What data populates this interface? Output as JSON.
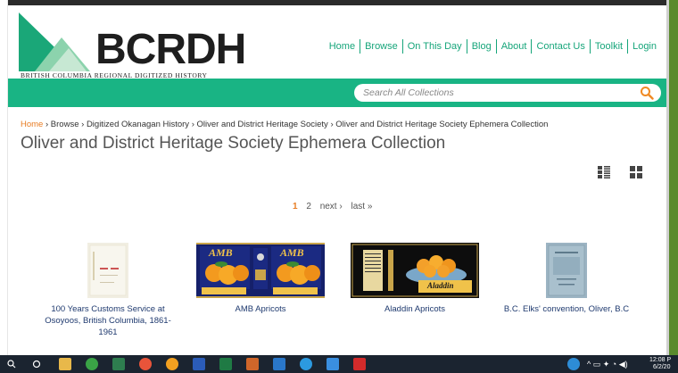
{
  "logo": {
    "word": "BCRDH",
    "subtitle": "BRITISH COLUMBIA REGIONAL DIGITIZED HISTORY"
  },
  "nav": {
    "items": [
      "Home",
      "Browse",
      "On This Day",
      "Blog",
      "About",
      "Contact Us",
      "Toolkit",
      "Login"
    ]
  },
  "search": {
    "placeholder": "Search All Collections"
  },
  "breadcrumb": {
    "items": [
      "Home",
      "Browse",
      "Digitized Okanagan History",
      "Oliver and District Heritage Society",
      "Oliver and District Heritage Society Ephemera Collection"
    ],
    "separator": "›"
  },
  "page_title": "Oliver and District Heritage Society Ephemera Collection",
  "pager": {
    "current": "1",
    "next_page": "2",
    "next": "next ›",
    "last": "last »"
  },
  "items": [
    {
      "caption": "100 Years Customs Service at Osoyoos, British Columbia, 1861-1961"
    },
    {
      "caption": "AMB Apricots",
      "label": "AMB"
    },
    {
      "caption": "Aladdin Apricots",
      "label": "Aladdin"
    },
    {
      "caption": "B.C. Elks' convention, Oliver, B.C"
    }
  ],
  "taskbar": {
    "time": "12:08 P",
    "date": "6/2/20"
  },
  "colors": {
    "brand_green": "#19b484",
    "link_orange": "#e87d24",
    "nav_green": "#16a57a",
    "caption_blue": "#1f3a6f"
  }
}
